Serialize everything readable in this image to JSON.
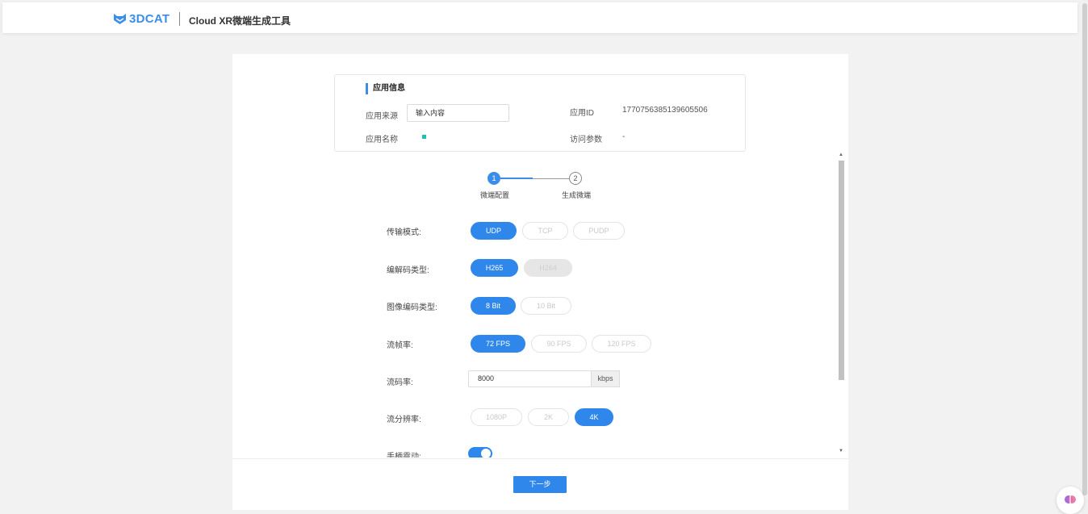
{
  "header": {
    "logo_text": "3DCAT",
    "title": "Cloud XR微端生成工具"
  },
  "info": {
    "section_title": "应用信息",
    "source_label": "应用来源",
    "source_placeholder": "输入内容",
    "name_label": "应用名称",
    "app_id_label": "应用ID",
    "app_id_value": "1770756385139605506",
    "params_label": "访问参数",
    "params_value": "-"
  },
  "stepper": {
    "steps": [
      {
        "num": "1",
        "label": "微端配置",
        "active": true
      },
      {
        "num": "2",
        "label": "生成微端",
        "active": false
      }
    ]
  },
  "form": {
    "transport": {
      "label": "传输模式:",
      "options": [
        "UDP",
        "TCP",
        "PUDP"
      ],
      "selected": "UDP"
    },
    "codec": {
      "label": "编解码类型:",
      "options": [
        "H265",
        "H264"
      ],
      "selected": "H265"
    },
    "image_codec": {
      "label": "图像编码类型:",
      "options": [
        "8 Bit",
        "10 Bit"
      ],
      "selected": "8 Bit"
    },
    "fps": {
      "label": "流帧率:",
      "options": [
        "72 FPS",
        "90 FPS",
        "120 FPS"
      ],
      "selected": "72 FPS"
    },
    "bitrate": {
      "label": "流码率:",
      "value": "8000",
      "unit": "kbps"
    },
    "resolution": {
      "label": "流分辨率:",
      "options": [
        "1080P",
        "2K",
        "4K"
      ],
      "selected": "4K"
    },
    "vibration": {
      "label": "手柄震动:",
      "enabled": true
    }
  },
  "footer": {
    "next_label": "下一步"
  },
  "colors": {
    "accent": "#2f87eb",
    "brand": "#3b8ee8",
    "dot": "#1ec2b0"
  }
}
